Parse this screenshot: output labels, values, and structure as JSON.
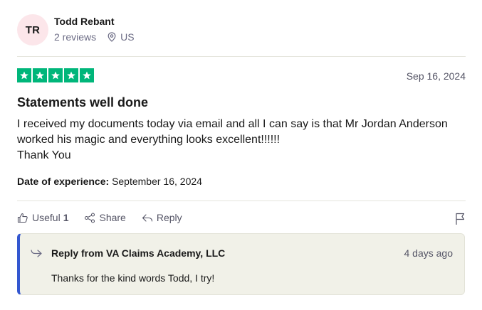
{
  "reviewer": {
    "initials": "TR",
    "name": "Todd Rebant",
    "reviews_count": "2 reviews",
    "country": "US"
  },
  "review": {
    "rating": 5,
    "date": "Sep 16, 2024",
    "title": "Statements well done",
    "body_lines": [
      "I received my documents today via email and all I can say is that Mr Jordan Anderson",
      "worked his magic and everything looks excellent!!!!!!",
      "Thank You"
    ],
    "experience_label": "Date of experience:",
    "experience_date": "September 16, 2024"
  },
  "actions": {
    "useful_label": "Useful",
    "useful_count": "1",
    "share_label": "Share",
    "reply_label": "Reply"
  },
  "company_reply": {
    "from": "Reply from VA Claims Academy, LLC",
    "age": "4 days ago",
    "text": "Thanks for the kind words Todd, I try!"
  },
  "colors": {
    "star_green": "#00b67a",
    "avatar_bg": "#fce6ea",
    "reply_accent": "#3357d0",
    "reply_bg": "#f1f1e8"
  },
  "icons": {
    "location": "location-pin-icon",
    "useful": "thumbs-up-icon",
    "share": "share-icon",
    "reply": "reply-arrow-icon",
    "flag": "flag-icon",
    "company_reply": "reply-indicator-icon"
  }
}
